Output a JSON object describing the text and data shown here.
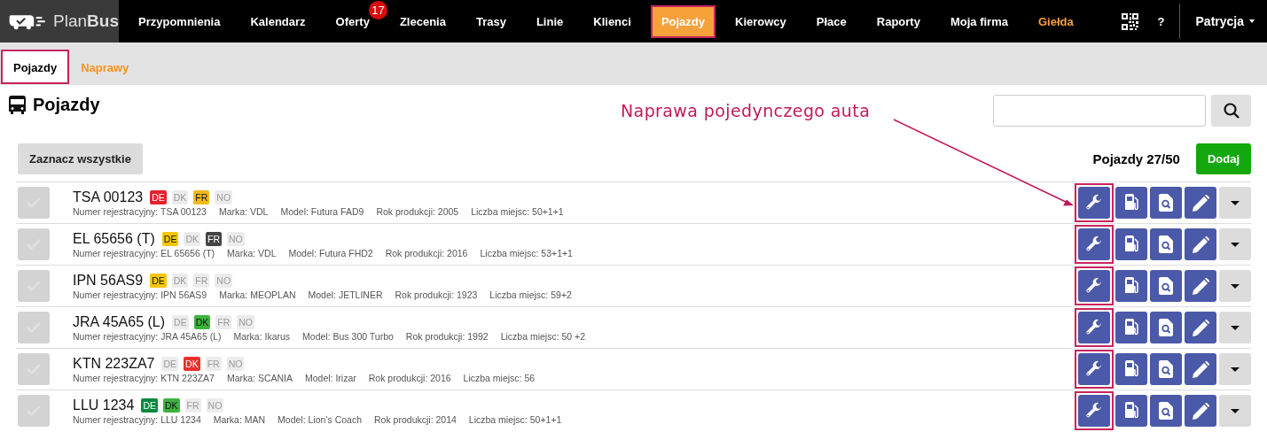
{
  "topbar": {
    "logo": {
      "light": "Plan",
      "bold": "Bus"
    },
    "nav": [
      {
        "label": "Przypomnienia",
        "selected": false,
        "highlighted": false
      },
      {
        "label": "Kalendarz",
        "selected": false,
        "highlighted": false
      },
      {
        "label": "Oferty",
        "selected": false,
        "highlighted": false,
        "badge": "17"
      },
      {
        "label": "Zlecenia",
        "selected": false,
        "highlighted": false
      },
      {
        "label": "Trasy",
        "selected": false,
        "highlighted": false
      },
      {
        "label": "Linie",
        "selected": false,
        "highlighted": false
      },
      {
        "label": "Klienci",
        "selected": false,
        "highlighted": false
      },
      {
        "label": "Pojazdy",
        "selected": true,
        "highlighted": false
      },
      {
        "label": "Kierowcy",
        "selected": false,
        "highlighted": false
      },
      {
        "label": "Płace",
        "selected": false,
        "highlighted": false
      },
      {
        "label": "Raporty",
        "selected": false,
        "highlighted": false
      },
      {
        "label": "Moja firma",
        "selected": false,
        "highlighted": false
      },
      {
        "label": "Giełda",
        "selected": false,
        "highlighted": true
      }
    ],
    "help": "?",
    "user": "Patrycja"
  },
  "subtabs": [
    {
      "label": "Pojazdy",
      "selected": true
    },
    {
      "label": "Naprawy",
      "selected": false
    }
  ],
  "page": {
    "title": "Pojazdy",
    "select_all": "Zaznacz wszystkie",
    "count": "Pojazdy 27/50",
    "add": "Dodaj"
  },
  "annotation": {
    "text": "Naprawa pojedynczego auta"
  },
  "vehicles": [
    {
      "plate": "TSA 00123",
      "checked": false,
      "highlighted": true,
      "tags": [
        {
          "label": "DE",
          "on": true,
          "color": "#e8212b"
        },
        {
          "label": "DK",
          "on": false
        },
        {
          "label": "FR",
          "on": true,
          "color": "#f2b81b"
        },
        {
          "label": "NO",
          "on": false
        }
      ],
      "details": [
        "Numer rejestracyjny: TSA 00123",
        "Marka: VDL",
        "Model: Futura FAD9",
        "Rok produkcji: 2005",
        "Liczba miejsc: 50+1+1"
      ]
    },
    {
      "plate": "EL 65656 (T)",
      "checked": false,
      "highlighted": true,
      "tags": [
        {
          "label": "DE",
          "on": true,
          "color": "#f7c600"
        },
        {
          "label": "DK",
          "on": false
        },
        {
          "label": "FR",
          "on": true,
          "color": "#444444"
        },
        {
          "label": "NO",
          "on": false
        }
      ],
      "details": [
        "Numer rejestracyjny: EL 65656 (T)",
        "Marka: VDL",
        "Model: Futura FHD2",
        "Rok produkcji: 2016",
        "Liczba miejsc: 53+1+1"
      ]
    },
    {
      "plate": "IPN 56AS9",
      "checked": false,
      "highlighted": true,
      "tags": [
        {
          "label": "DE",
          "on": true,
          "color": "#f7c600"
        },
        {
          "label": "DK",
          "on": false
        },
        {
          "label": "FR",
          "on": false
        },
        {
          "label": "NO",
          "on": false
        }
      ],
      "details": [
        "Numer rejestracyjny: IPN 56AS9",
        "Marka: MEOPLAN",
        "Model: JETLINER",
        "Rok produkcji: 1923",
        "Liczba miejsc: 59+2"
      ]
    },
    {
      "plate": "JRA 45A65 (L)",
      "checked": false,
      "highlighted": true,
      "tags": [
        {
          "label": "DE",
          "on": false
        },
        {
          "label": "DK",
          "on": true,
          "color": "#3db33d"
        },
        {
          "label": "FR",
          "on": false
        },
        {
          "label": "NO",
          "on": false
        }
      ],
      "details": [
        "Numer rejestracyjny: JRA 45A65 (L)",
        "Marka: Ikarus",
        "Model: Bus 300 Turbo",
        "Rok produkcji: 1992",
        "Liczba miejsc: 50 +2"
      ]
    },
    {
      "plate": "KTN 223ZA7",
      "checked": false,
      "highlighted": true,
      "tags": [
        {
          "label": "DE",
          "on": false
        },
        {
          "label": "DK",
          "on": true,
          "color": "#e8312a"
        },
        {
          "label": "FR",
          "on": false
        },
        {
          "label": "NO",
          "on": false
        }
      ],
      "details": [
        "Numer rejestracyjny: KTN 223ZA7",
        "Marka: SCANIA",
        "Model: Irizar",
        "Rok produkcji: 2016",
        "Liczba miejsc: 56"
      ]
    },
    {
      "plate": "LLU 1234",
      "checked": false,
      "highlighted": true,
      "tags": [
        {
          "label": "DE",
          "on": true,
          "color": "#0b8a3e"
        },
        {
          "label": "DK",
          "on": true,
          "color": "#3db33d"
        },
        {
          "label": "FR",
          "on": false
        },
        {
          "label": "NO",
          "on": false
        }
      ],
      "details": [
        "Numer rejestracyjny: LLU 1234",
        "Marka: MAN",
        "Model: Lion’s Coach",
        "Rok produkcji: 2014",
        "Liczba miejsc: 50+1+1"
      ]
    }
  ]
}
